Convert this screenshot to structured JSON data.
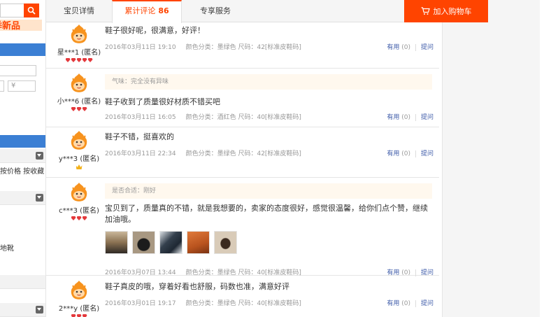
{
  "tabs": [
    {
      "label": "宝贝详情",
      "active": false
    },
    {
      "label": "累计评论",
      "count": "86",
      "active": true
    },
    {
      "label": "专享服务",
      "active": false
    }
  ],
  "cart_button": "加入购物车",
  "sidebar": {
    "promo": "季新品",
    "price_symbol": "¥",
    "sort_text": "按价格 按收藏",
    "category_text": "地靴"
  },
  "reviews": [
    {
      "user": "星***1 (匿名)",
      "level": "diamond5",
      "content": "鞋子很好呢，很满意，好评！",
      "date": "2016年03月11日 19:10",
      "sku": "颜色分类：墨绿色   尺码：42[标准皮鞋码]",
      "useful_label": "有用",
      "useful_count": "(0)",
      "ask_label": "提问"
    },
    {
      "user": "小***6 (匿名)",
      "level": "diamond3",
      "tag": "气味：完全没有异味",
      "content": "鞋子收到了质量很好材质不错买吧",
      "date": "2016年03月11日 16:05",
      "sku": "颜色分类：酒红色   尺码：40[标准皮鞋码]",
      "useful_label": "有用",
      "useful_count": "(0)",
      "ask_label": "提问"
    },
    {
      "user": "y***3 (匿名)",
      "level": "crown1",
      "content": "鞋子不错，挺喜欢的",
      "date": "2016年03月11日 22:34",
      "sku": "颜色分类：墨绿色   尺码：42[标准皮鞋码]",
      "useful_label": "有用",
      "useful_count": "(0)",
      "ask_label": "提问"
    },
    {
      "user": "c***3 (匿名)",
      "level": "diamond3",
      "tag": "是否合适：刚好",
      "content": "宝贝到了，质量真的不错，就是我想要的，卖家的态度很好，感觉很温馨，给你们点个赞，继续加油哦。",
      "photos": [
        "photo-1",
        "photo-2",
        "photo-3",
        "photo-4",
        "photo-5"
      ],
      "date": "2016年03月07日 13:44",
      "sku": "颜色分类：墨绿色   尺码：40[标准皮鞋码]",
      "useful_label": "有用",
      "useful_count": "(0)",
      "ask_label": "提问"
    },
    {
      "user": "2***y (匿名)",
      "level": "diamond3",
      "content": "鞋子真皮的哦，穿着好看也舒服，码数也准，满意好评",
      "date": "2016年03月01日 19:17",
      "sku": "颜色分类：墨绿色   尺码：40[标准皮鞋码]",
      "useful_label": "有用",
      "useful_count": "(0)",
      "ask_label": "提问"
    }
  ],
  "colors": {
    "accent": "#ff4400",
    "link": "#3c5aa8",
    "sidebar_blue": "#3b7fd4"
  }
}
